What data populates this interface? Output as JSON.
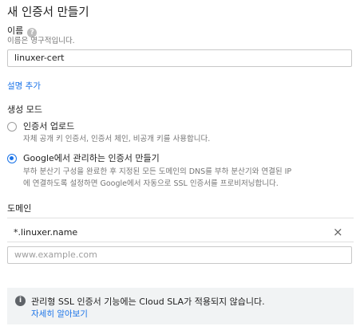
{
  "page": {
    "title": "새 인증서 만들기"
  },
  "name_field": {
    "label": "이름",
    "help_icon": "help-icon",
    "hint": "이름은 영구적입니다.",
    "value": "linuxer-cert"
  },
  "add_description_link": "설명 추가",
  "creation_mode": {
    "heading": "생성 모드",
    "options": [
      {
        "label": "인증서 업로드",
        "description": "자체 공개 키 인증서, 인증서 체인, 비공개 키를 사용합니다.",
        "selected": false
      },
      {
        "label": "Google에서 관리하는 인증서 만들기",
        "description_line1": "부하 분산기 구성을 완료한 후 지정된 모든 도메인의 DNS를 부하 분산기와 연결된 IP",
        "description_line2": "에 연결하도록 설정하면 Google에서 자동으로 SSL 인증서를 프로비저닝합니다.",
        "selected": true
      }
    ]
  },
  "domains": {
    "heading": "도메인",
    "entries": [
      "*.linuxer.name"
    ],
    "remove_icon": "close-icon",
    "new_placeholder": "www.example.com"
  },
  "notice": {
    "icon": "info-icon",
    "text": "관리형 SSL 인증서 기능에는 Cloud SLA가 적용되지 않습니다.",
    "link": "자세히 알아보기"
  },
  "colors": {
    "accent": "#1a73e8",
    "notice_bg": "#f1f3f4"
  }
}
